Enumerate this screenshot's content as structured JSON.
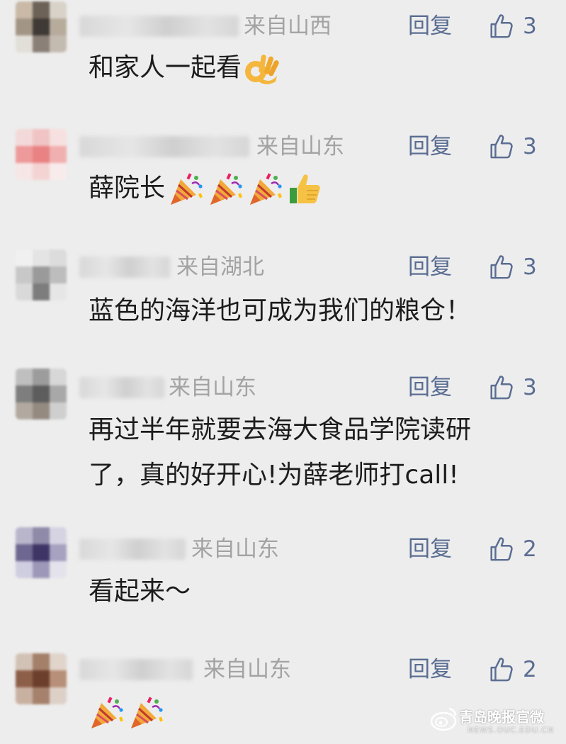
{
  "comments": [
    {
      "region": "来自山西",
      "reply": "回复",
      "likes": "3",
      "text": "和家人一起看",
      "emojis": [
        "ok-hand-emoji"
      ]
    },
    {
      "region": "来自山东",
      "reply": "回复",
      "likes": "3",
      "text": "薛院长",
      "emojis": [
        "party-popper-emoji",
        "party-popper-emoji",
        "party-popper-emoji",
        "thumbs-up-emoji"
      ]
    },
    {
      "region": "来自湖北",
      "reply": "回复",
      "likes": "3",
      "text": "蓝色的海洋也可成为我们的粮仓！",
      "emojis": []
    },
    {
      "region": "来自山东",
      "reply": "回复",
      "likes": "3",
      "text_line1": "再过半年就要去海大食品学院读研",
      "text_line2": "了，真的好开心!为薛老师打call!",
      "emojis": []
    },
    {
      "region": "来自山东",
      "reply": "回复",
      "likes": "2",
      "text": "看起来～",
      "emojis": []
    },
    {
      "region": "来自山东",
      "reply": "回复",
      "likes": "2",
      "text": "",
      "emojis": [
        "party-popper-emoji",
        "party-popper-emoji"
      ]
    }
  ],
  "watermark": {
    "title": "青岛晚报官微",
    "sub": "NEWS.OUC.EDU.CN"
  },
  "colors": {
    "background": "#ededed",
    "link": "#5a6d92",
    "meta": "#a3a3a3",
    "text": "#1c1c1c"
  }
}
